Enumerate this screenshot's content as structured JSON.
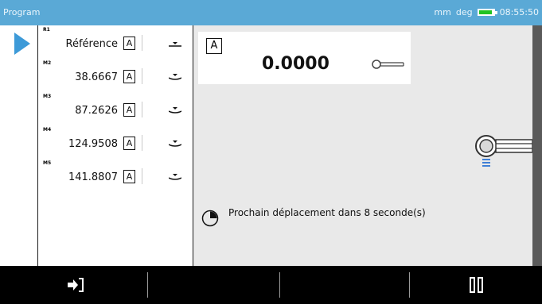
{
  "titlebar": {
    "title": "Program",
    "units_length": "mm",
    "units_angle": "deg",
    "time": "08:55:50"
  },
  "measurements": [
    {
      "tag": "R1",
      "value": "Référence",
      "mode": "A"
    },
    {
      "tag": "M2",
      "value": "38.6667",
      "mode": "A"
    },
    {
      "tag": "M3",
      "value": "87.2626",
      "mode": "A"
    },
    {
      "tag": "M4",
      "value": "124.9508",
      "mode": "A"
    },
    {
      "tag": "M5",
      "value": "141.8807",
      "mode": "A"
    }
  ],
  "display": {
    "mode": "A",
    "value": "0.0000"
  },
  "status": {
    "message": "Prochain déplacement dans 8 seconde(s)"
  },
  "colors": {
    "titlebar": "#5aa9d6",
    "play_arrow": "#3d9ad8",
    "battery": "#22c322",
    "probe_light": "#3f7fd6"
  },
  "icons": {
    "play": "play-icon",
    "exit": "exit-icon",
    "pause": "pause-icon",
    "clock": "clock-icon",
    "probe": "probe-icon"
  }
}
